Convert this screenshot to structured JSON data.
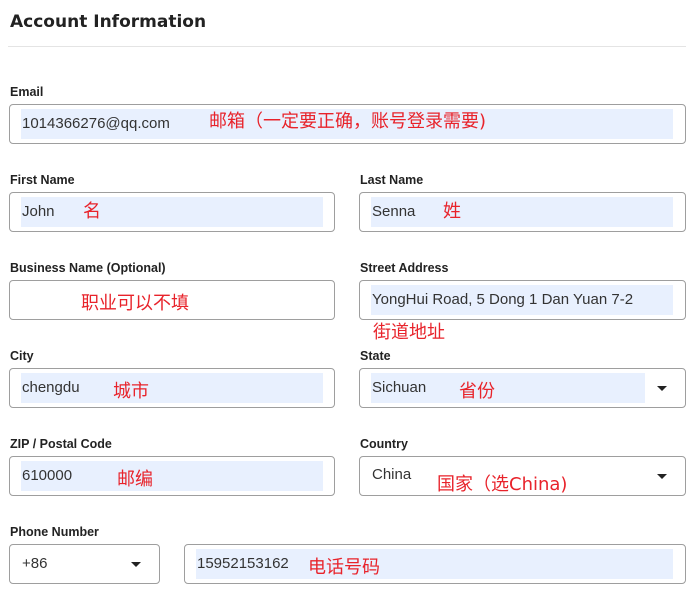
{
  "section": {
    "title": "Account Information"
  },
  "fields": {
    "email": {
      "label": "Email",
      "value": "1014366276@qq.com",
      "note": "邮箱（一定要正确，账号登录需要)"
    },
    "first_name": {
      "label": "First Name",
      "value": "John",
      "note": "名"
    },
    "last_name": {
      "label": "Last Name",
      "value": "Senna",
      "note": "姓"
    },
    "business_name": {
      "label": "Business Name (Optional)",
      "value": "",
      "note": "职业可以不填"
    },
    "street_address": {
      "label": "Street Address",
      "value": "YongHui Road, 5 Dong 1 Dan Yuan 7-2",
      "note": "街道地址"
    },
    "city": {
      "label": "City",
      "value": "chengdu",
      "note": "城市"
    },
    "state": {
      "label": "State",
      "value": "Sichuan",
      "note": "省份",
      "icon": "caret-down-icon"
    },
    "zip": {
      "label": "ZIP / Postal Code",
      "value": "610000",
      "note": "邮编"
    },
    "country": {
      "label": "Country",
      "value": "China",
      "note": "国家（选China)",
      "icon": "caret-down-icon"
    },
    "phone": {
      "label": "Phone Number",
      "country_code": "+86",
      "value": "15952153162",
      "note": "电话号码",
      "icon": "caret-down-icon"
    }
  },
  "colors": {
    "annotation": "#e8232b",
    "autofill_background": "#e8f0fe",
    "border": "#9e9e9e"
  }
}
